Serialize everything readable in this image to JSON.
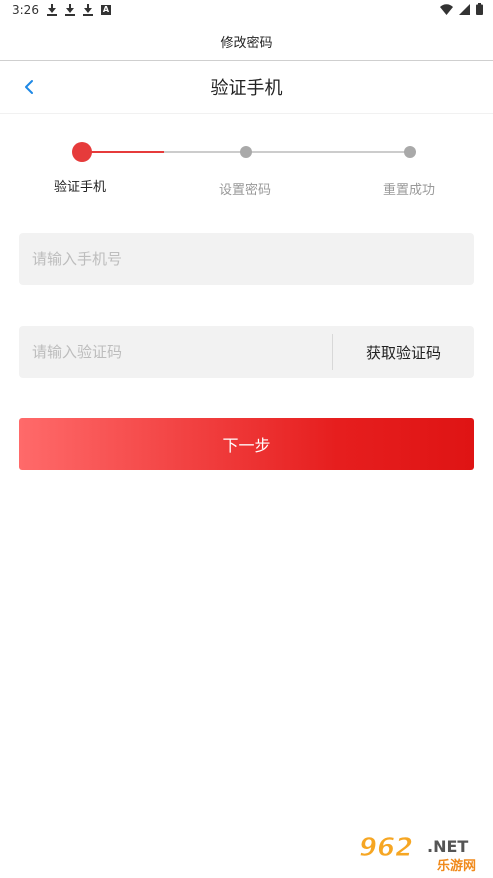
{
  "status_bar": {
    "time": "3:26",
    "icons": [
      "download-icon",
      "download-icon",
      "download-icon",
      "a-icon",
      "wifi-icon",
      "signal-icon",
      "battery-icon"
    ]
  },
  "app": {
    "title": "修改密码"
  },
  "header": {
    "title": "验证手机",
    "back_icon": "chevron-left-icon"
  },
  "stepper": {
    "steps": [
      {
        "label": "验证手机",
        "active": true
      },
      {
        "label": "设置密码",
        "active": false
      },
      {
        "label": "重置成功",
        "active": false
      }
    ],
    "active_color": "#e63b3b",
    "inactive_color": "#bdbdbd"
  },
  "form": {
    "phone": {
      "value": "",
      "placeholder": "请输入手机号"
    },
    "code": {
      "value": "",
      "placeholder": "请输入验证码"
    },
    "get_code_label": "获取验证码",
    "submit_label": "下一步"
  },
  "watermark": {
    "brand": "962",
    "suffix": ".NET",
    "text": "乐游网"
  },
  "colors": {
    "accent": "#e61e1e",
    "back_icon": "#1e88e5",
    "field_bg": "#f2f2f2"
  }
}
